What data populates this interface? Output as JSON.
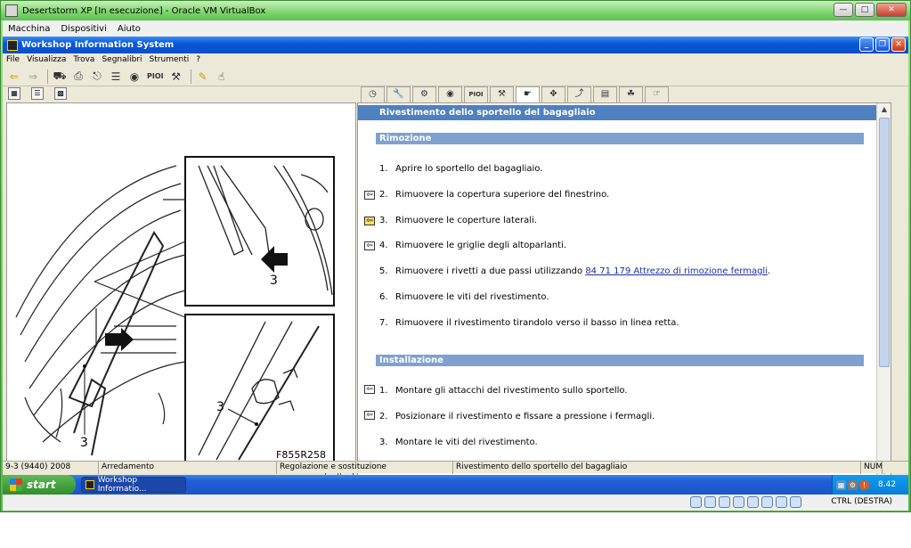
{
  "host": {
    "title": "Desertstorm XP [In esecuzione] - Oracle VM VirtualBox",
    "menu": [
      "Macchina",
      "Dispositivi",
      "Aiuto"
    ],
    "host_key": "CTRL (DESTRA)"
  },
  "app": {
    "title": "Workshop Information System",
    "menu": [
      "File",
      "Visualizza",
      "Trova",
      "Segnalibri",
      "Strumenti",
      "?"
    ],
    "toolbar_pio_label": "PIOI",
    "tab_pio_label": "PIOI"
  },
  "diagram": {
    "code": "F855R258",
    "callouts": [
      "3",
      "3",
      "3"
    ]
  },
  "document": {
    "title": "Rivestimento dello sportello del bagagliaio",
    "sections": [
      {
        "heading": "Rimozione",
        "steps": [
          {
            "num": "1.",
            "text": "Aprire lo sportello del bagagliaio."
          },
          {
            "num": "2.",
            "text": "Rimuovere la copertura superiore del finestrino."
          },
          {
            "num": "3.",
            "text": "Rimuovere le coperture laterali."
          },
          {
            "num": "4.",
            "text": "Rimuovere le griglie degli altoparlanti."
          },
          {
            "num": "5.",
            "text": "Rimuovere i rivetti a due passi utilizzando ",
            "link": "84 71 179 Attrezzo di rimozione fermagli",
            "after": "."
          },
          {
            "num": "6.",
            "text": "Rimuovere le viti del rivestimento."
          },
          {
            "num": "7.",
            "text": "Rimuovere il rivestimento tirandolo verso il basso in linea retta."
          }
        ]
      },
      {
        "heading": "Installazione",
        "steps": [
          {
            "num": "1.",
            "text": "Montare gli attacchi del rivestimento sullo sportello."
          },
          {
            "num": "2.",
            "text": "Posizionare il rivestimento e fissare a pressione i fermagli."
          },
          {
            "num": "3.",
            "text": "Montare le viti del rivestimento."
          }
        ]
      }
    ]
  },
  "status": {
    "model": "9-3 (9440) 2008",
    "group": "Arredamento",
    "operation": "Regolazione e sostituzione",
    "topic": "Rivestimento dello sportello del bagagliaio",
    "num": "NUM"
  },
  "taskbar": {
    "start": "start",
    "task": "Workshop Informatio...",
    "time": "8.42"
  }
}
